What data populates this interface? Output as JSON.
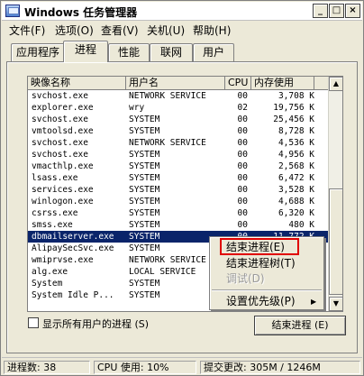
{
  "window": {
    "title": "Windows 任务管理器"
  },
  "titlebar_buttons": {
    "minimize": "_",
    "maximize": "□",
    "close": "×"
  },
  "menu": [
    "文件(F)",
    "选项(O)",
    "查看(V)",
    "关机(U)",
    "帮助(H)"
  ],
  "tabs": [
    {
      "label": "应用程序",
      "active": false
    },
    {
      "label": "进程",
      "active": true
    },
    {
      "label": "性能",
      "active": false
    },
    {
      "label": "联网",
      "active": false
    },
    {
      "label": "用户",
      "active": false
    }
  ],
  "columns": [
    "映像名称",
    "用户名",
    "CPU",
    "内存使用"
  ],
  "rows": [
    {
      "name": "svchost.exe",
      "user": "NETWORK SERVICE",
      "cpu": "00",
      "mem": "3,708 K"
    },
    {
      "name": "explorer.exe",
      "user": "wry",
      "cpu": "02",
      "mem": "19,756 K"
    },
    {
      "name": "svchost.exe",
      "user": "SYSTEM",
      "cpu": "00",
      "mem": "25,456 K"
    },
    {
      "name": "vmtoolsd.exe",
      "user": "SYSTEM",
      "cpu": "00",
      "mem": "8,728 K"
    },
    {
      "name": "svchost.exe",
      "user": "NETWORK SERVICE",
      "cpu": "00",
      "mem": "4,536 K"
    },
    {
      "name": "svchost.exe",
      "user": "SYSTEM",
      "cpu": "00",
      "mem": "4,956 K"
    },
    {
      "name": "vmacthlp.exe",
      "user": "SYSTEM",
      "cpu": "00",
      "mem": "2,568 K"
    },
    {
      "name": "lsass.exe",
      "user": "SYSTEM",
      "cpu": "00",
      "mem": "6,472 K"
    },
    {
      "name": "services.exe",
      "user": "SYSTEM",
      "cpu": "00",
      "mem": "3,528 K"
    },
    {
      "name": "winlogon.exe",
      "user": "SYSTEM",
      "cpu": "00",
      "mem": "4,688 K"
    },
    {
      "name": "csrss.exe",
      "user": "SYSTEM",
      "cpu": "00",
      "mem": "6,320 K"
    },
    {
      "name": "smss.exe",
      "user": "SYSTEM",
      "cpu": "00",
      "mem": "480 K"
    },
    {
      "name": "dbmailserver.exe",
      "user": "SYSTEM",
      "cpu": "00",
      "mem": "11,772 K",
      "selected": true
    },
    {
      "name": "AlipaySecSvc.exe",
      "user": "SYSTEM",
      "cpu": "",
      "mem": ""
    },
    {
      "name": "wmiprvse.exe",
      "user": "NETWORK SERVICE",
      "cpu": "",
      "mem": ""
    },
    {
      "name": "alg.exe",
      "user": "LOCAL SERVICE",
      "cpu": "",
      "mem": ""
    },
    {
      "name": "System",
      "user": "SYSTEM",
      "cpu": "",
      "mem": ""
    },
    {
      "name": "System Idle P...",
      "user": "SYSTEM",
      "cpu": "",
      "mem": ""
    }
  ],
  "scroll": {
    "up": "▲",
    "down": "▼"
  },
  "show_all_users": {
    "label": "显示所有用户的进程 (S)",
    "checked": false
  },
  "end_process_button": "结束进程 (E)",
  "context_menu": {
    "items": [
      {
        "label": "结束进程(E)",
        "enabled": true,
        "highlighted": true
      },
      {
        "label": "结束进程树(T)",
        "enabled": true
      },
      {
        "label": "调试(D)",
        "enabled": false
      },
      {
        "label": "设置优先级(P)",
        "enabled": true,
        "submenu": true
      }
    ],
    "submenu_arrow": "▶"
  },
  "status": {
    "process_count": "进程数: 38",
    "cpu_usage": "CPU 使用: 10%",
    "commit": "提交更改: 305M / 1246M"
  },
  "colors": {
    "selection": "#0a246a",
    "highlight_box": "#e00000",
    "face": "#ece9d8"
  }
}
